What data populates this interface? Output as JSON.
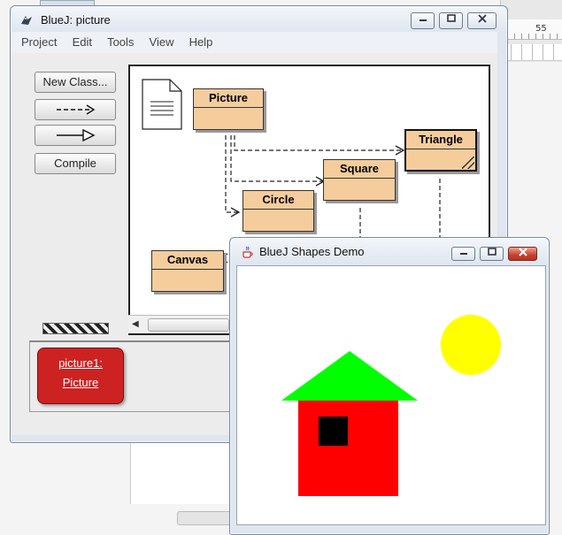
{
  "background": {
    "ruler_number": "55"
  },
  "bluej": {
    "title": "BlueJ:  picture",
    "menu": [
      "Project",
      "Edit",
      "Tools",
      "View",
      "Help"
    ],
    "buttons": {
      "new_class": "New Class...",
      "compile": "Compile",
      "uses_arrow": "- - ->",
      "inherit_arrow": "——▷"
    },
    "classes": {
      "picture": "Picture",
      "triangle": "Triangle",
      "square": "Square",
      "circle": "Circle",
      "canvas": "Canvas"
    },
    "object_bench": {
      "object_name": "picture1:",
      "object_type": "Picture"
    }
  },
  "shapes_demo": {
    "title": "BlueJ Shapes Demo",
    "colors": {
      "sun": "#ffff00",
      "roof": "#00ff00",
      "wall": "#ff0000",
      "window": "#000000"
    }
  },
  "colors": {
    "class_fill": "#f5cd9c",
    "object_fill": "#cc2222",
    "close_button": "#c4412d"
  }
}
